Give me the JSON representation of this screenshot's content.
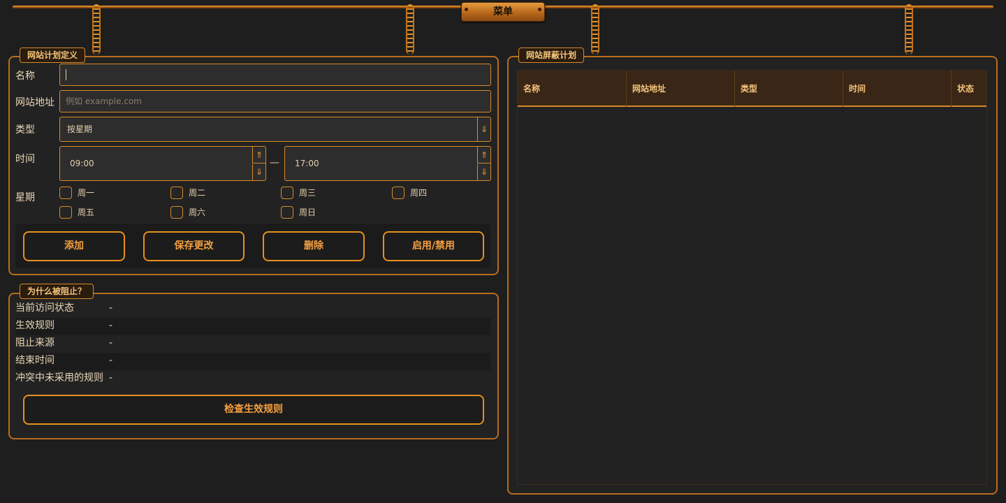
{
  "menu": {
    "label": "菜单"
  },
  "schedule_form": {
    "title": "网站计划定义",
    "name": {
      "label": "名称",
      "value": ""
    },
    "url": {
      "label": "网站地址",
      "placeholder": "例如 example.com"
    },
    "type": {
      "label": "类型",
      "value": "按星期"
    },
    "time": {
      "label": "时间",
      "start": "09:00",
      "separator": "—",
      "end": "17:00"
    },
    "weekdays": {
      "label": "星期",
      "days": [
        {
          "label": "周一",
          "checked": false
        },
        {
          "label": "周二",
          "checked": false
        },
        {
          "label": "周三",
          "checked": false
        },
        {
          "label": "周四",
          "checked": false
        },
        {
          "label": "周五",
          "checked": false
        },
        {
          "label": "周六",
          "checked": false
        },
        {
          "label": "周日",
          "checked": false
        }
      ]
    },
    "buttons": {
      "add": "添加",
      "save": "保存更改",
      "delete": "删除",
      "toggle": "启用/禁用"
    }
  },
  "why_blocked": {
    "title": "为什么被阻止？",
    "rows": [
      {
        "label": "当前访问状态",
        "value": "-"
      },
      {
        "label": "生效规则",
        "value": "-"
      },
      {
        "label": "阻止来源",
        "value": "-"
      },
      {
        "label": "结束时间",
        "value": "-"
      },
      {
        "label": "冲突中未采用的规则",
        "value": "-"
      }
    ],
    "check_button": "检查生效规则"
  },
  "schedule_table": {
    "title": "网站屏蔽计划",
    "columns": [
      "名称",
      "网站地址",
      "类型",
      "时间",
      "状态"
    ],
    "rows": []
  },
  "colors": {
    "accent": "#e6901e",
    "background": "#1e1e1e",
    "panel_border": "#b86d1c",
    "text": "#e8d6b8"
  }
}
